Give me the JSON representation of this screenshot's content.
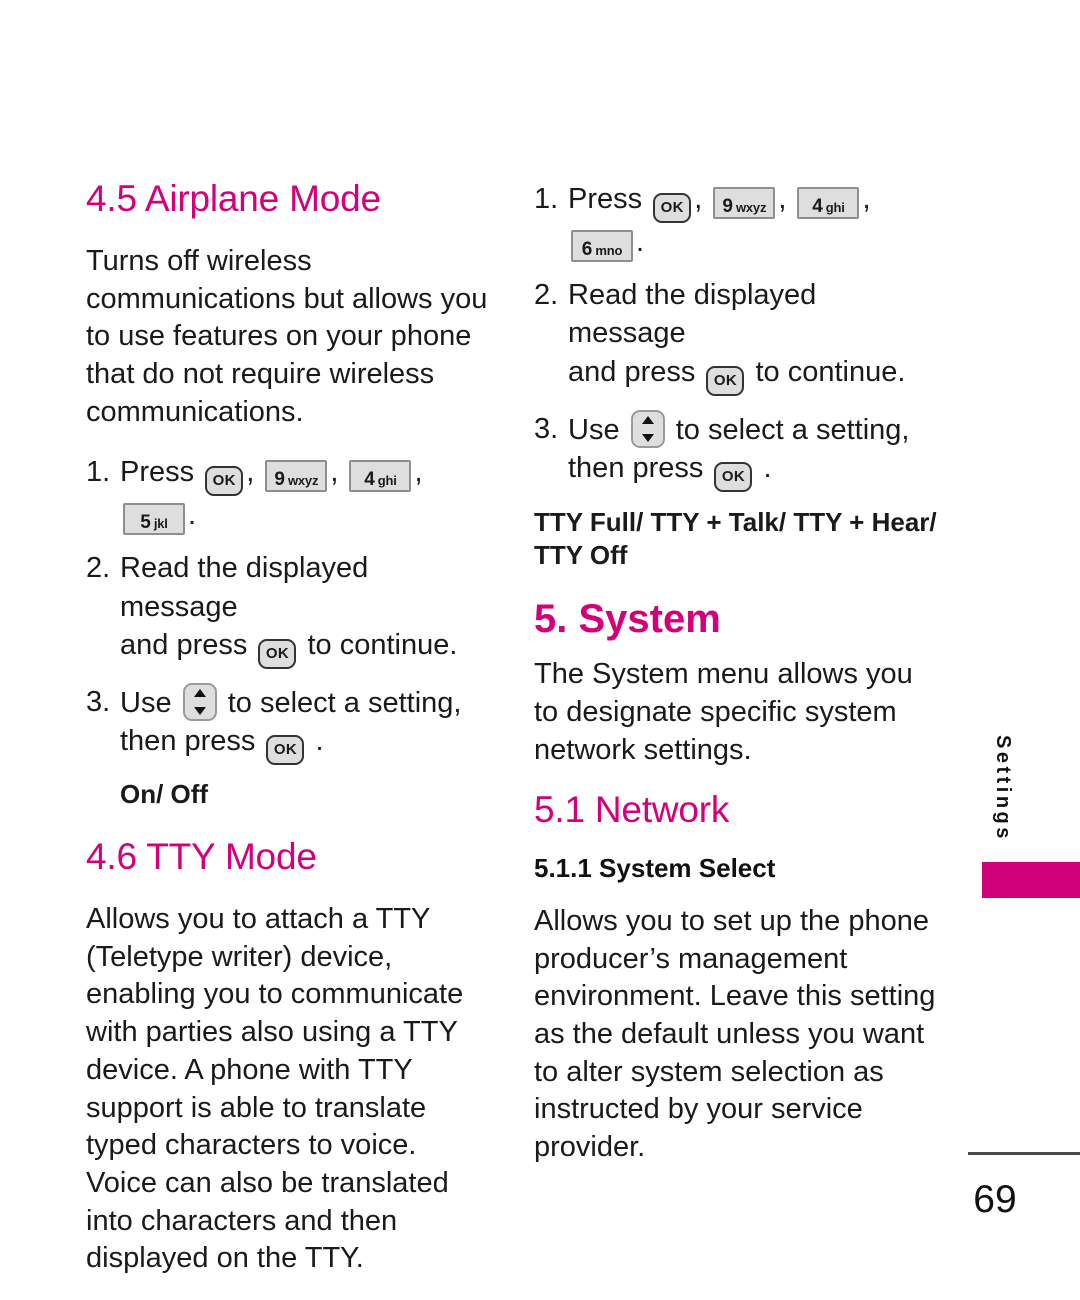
{
  "document": {
    "page_number": "69",
    "edge_tab_label": "Settings",
    "accent_color": "#D4007A",
    "tab_color": "#D1007B"
  },
  "left_column": {
    "heading_45": "4.5 Airplane Mode",
    "airplane_intro": "Turns off wireless communications but allows you to use features on your phone that do not require wireless communications.",
    "steps": [
      {
        "num": "1.",
        "line1_pre": "Press",
        "keys": [
          {
            "type": "ok",
            "label": "OK"
          },
          {
            "type": "num",
            "digit": "9",
            "letters": "wxyz"
          },
          {
            "type": "num",
            "digit": "4",
            "letters": "ghi"
          },
          {
            "type": "num",
            "digit": "5",
            "letters": "jkl"
          }
        ],
        "line1_post": "."
      },
      {
        "num": "2.",
        "line1": "Read the displayed message",
        "line2_pre": "and press",
        "line2_key": {
          "type": "ok",
          "label": "OK"
        },
        "line2_post": "to continue."
      },
      {
        "num": "3.",
        "line1_pre": "Use",
        "line1_key": {
          "type": "nav",
          "label": "up-down-nav"
        },
        "line1_post": "to select a setting,",
        "line2_pre": "then press",
        "line2_key": {
          "type": "ok",
          "label": "OK"
        },
        "line2_post": "."
      }
    ],
    "airplane_options": "On/ Off",
    "heading_46": "4.6 TTY Mode",
    "tty_intro": "Allows you to attach a TTY (Teletype writer) device, enabling you to communicate with parties also using a TTY device. A phone with TTY support is able to translate typed characters to voice. Voice can also be translated into characters and then displayed on the TTY."
  },
  "right_column": {
    "steps": [
      {
        "num": "1.",
        "line1_pre": "Press",
        "keys": [
          {
            "type": "ok",
            "label": "OK"
          },
          {
            "type": "num",
            "digit": "9",
            "letters": "wxyz"
          },
          {
            "type": "num",
            "digit": "4",
            "letters": "ghi"
          },
          {
            "type": "num",
            "digit": "6",
            "letters": "mno"
          }
        ],
        "line1_post": "."
      },
      {
        "num": "2.",
        "line1": "Read the displayed message",
        "line2_pre": "and press",
        "line2_key": {
          "type": "ok",
          "label": "OK"
        },
        "line2_post": "to continue."
      },
      {
        "num": "3.",
        "line1_pre": "Use",
        "line1_key": {
          "type": "nav",
          "label": "up-down-nav"
        },
        "line1_post": "to select a setting,",
        "line2_pre": "then press",
        "line2_key": {
          "type": "ok",
          "label": "OK"
        },
        "line2_post": "."
      }
    ],
    "tty_options": "TTY Full/ TTY + Talk/ TTY + Hear/ TTY Off",
    "heading_5": "5. System",
    "system_intro": "The System menu allows you to designate specific system network settings.",
    "heading_51": "5.1 Network",
    "heading_511": "5.1.1 System Select",
    "system_select_body": "Allows you to set up the phone producer’s management environment. Leave this setting as the default unless you want to alter system selection as instructed by your service provider."
  }
}
